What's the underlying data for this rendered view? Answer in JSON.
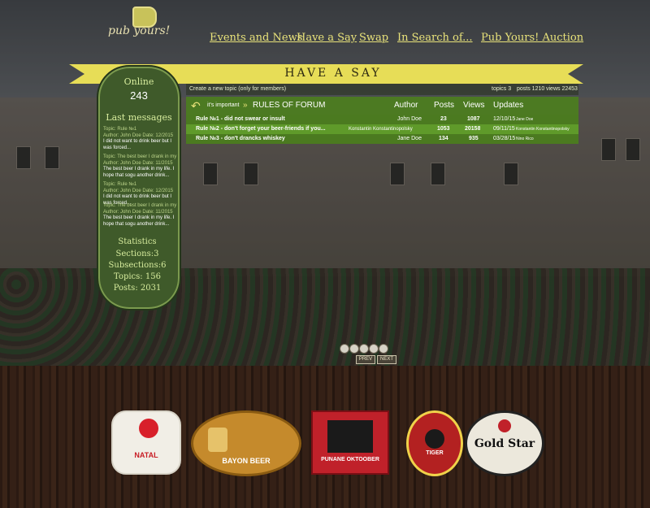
{
  "brand": {
    "logo_text": "pub yours!"
  },
  "nav": {
    "items": [
      {
        "label": "Events and News"
      },
      {
        "label": "Have a Say"
      },
      {
        "label": "Swap"
      },
      {
        "label": "In Search of..."
      },
      {
        "label": "Pub Yours! Auction"
      }
    ]
  },
  "banner": {
    "title": "HAVE A SAY"
  },
  "sidebar": {
    "online_label": "Online",
    "online_count": "243",
    "last_messages_label": "Last messages",
    "messages": [
      {
        "topic": "Topic: Rule №1",
        "meta": "Author: John Doe Date: 12/2015",
        "text": "I did not want to drink beer but I was forced..."
      },
      {
        "topic": "Topic: The best beer I drank in my",
        "meta": "Author: John Doe Date: 11/2015",
        "text": "The best beer I drank in my life. I hope that sogu another drink..."
      },
      {
        "topic": "Topic: Rule №1",
        "meta": "Author: John Doe Date: 12/2015",
        "text": "I did not want to drink beer but I was forced..."
      },
      {
        "topic": "Topic: The best beer I drank in my",
        "meta": "Author: John Doe Date: 11/2015",
        "text": "The best beer I drank in my life. I hope that sogu another drink..."
      }
    ],
    "statistics_label": "Statistics",
    "stats": [
      "Sections:3",
      "Subsections:6",
      "Topics: 156",
      "Posts: 2031"
    ]
  },
  "forum": {
    "create_topic": "Create a new topic (only for members)",
    "summary": {
      "topics": "topics 3",
      "posts": "posts 1210",
      "views": "views 22453"
    },
    "back_label": "it's important",
    "section_title": "RULES OF FORUM",
    "columns": [
      "Author",
      "Posts",
      "Views",
      "Updates"
    ],
    "rows": [
      {
        "title": "Rule №1 - did not swear or insult",
        "author": "John Doe",
        "posts": "23",
        "views": "1087",
        "date": "12/10/15",
        "updater": "Jane Doe"
      },
      {
        "title": "Rule №2 - don't forget your beer-friends if you...",
        "author": "Konstantin Konstantinopolsky",
        "posts": "1053",
        "views": "20158",
        "date": "09/11/15",
        "updater": "Konstantin Konstantinopolsky"
      },
      {
        "title": "Rule №3 - don't drancks whiskey",
        "author": "Jane Doe",
        "posts": "134",
        "views": "935",
        "date": "03/28/15",
        "updater": "Nino Rico"
      }
    ]
  },
  "pager": {
    "prev": "PREV",
    "next": "NEXT",
    "dots": 5
  },
  "beers": [
    {
      "name": "NATAL",
      "icon": "cuca-badge"
    },
    {
      "name": "BAYON BEER",
      "icon": "bayon-badge"
    },
    {
      "name": "PUNANE OKTOOBER",
      "icon": "oktoober-badge"
    },
    {
      "name": "TIGER",
      "icon": "tiger-badge"
    },
    {
      "name": "Gold Star",
      "icon": "goldstar-badge"
    }
  ],
  "colors": {
    "accent": "#e9e37a",
    "green": "#4b7a20",
    "banner": "#e7dd57"
  }
}
